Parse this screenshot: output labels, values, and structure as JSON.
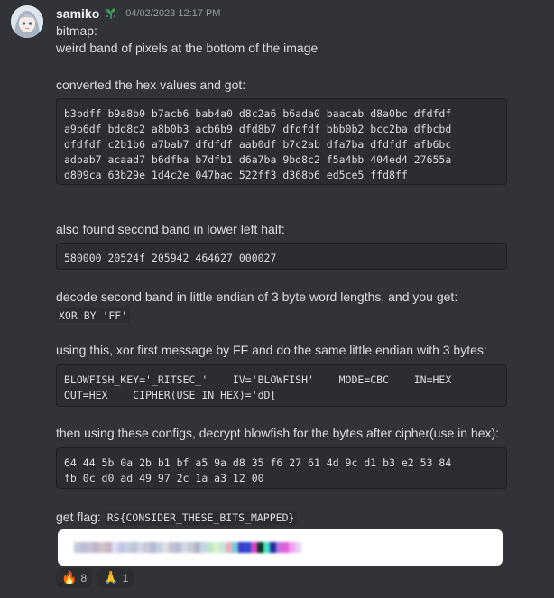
{
  "message": {
    "username": "samiko",
    "timestamp": "04/02/2023 12:17 PM",
    "lines": {
      "l1": "bitmap:",
      "l2": "weird band of pixels at the bottom of the image",
      "l3": "converted the hex values and got:",
      "l4": "also found second band in lower left half:",
      "l5": "decode second band in little endian of 3 byte word lengths, and you get:",
      "l6_code": "XOR BY 'FF'",
      "l7": "using this, xor first message by FF and do the same little endian with 3 bytes:",
      "l8": "then using these configs, decrypt blowfish for the bytes after cipher(use in hex):",
      "l9_prefix": "get flag:",
      "l9_code": "RS{CONSIDER_THESE_BITS_MAPPED}"
    },
    "code_blocks": {
      "hex1": "b3bdff b9a8b0 b7acb6 bab4a0 d8c2a6 b6ada0 baacab d8a0bc dfdfdf\na9b6df bdd8c2 a8b0b3 acb6b9 dfd8b7 dfdfdf bbb0b2 bcc2ba dfbcbd\ndfdfdf c2b1b6 a7bab7 dfdfdf aab0df b7c2ab dfa7ba dfdfdf afb6bc\nadbab7 acaad7 b6dfba b7dfb1 d6a7ba 9bd8c2 f5a4bb 404ed4 27655a\nd809ca 63b29e 1d4c2e 047bac 522ff3 d368b6 ed5ce5 ffd8ff",
      "hex2": "580000 20524f 205942 464627 000027",
      "config": "BLOWFISH_KEY='_RITSEC_'    IV='BLOWFISH'    MODE=CBC    IN=HEX\nOUT=HEX    CIPHER(USE IN HEX)='dD[",
      "cipher": "64 44 5b 0a 2b b1 bf a5 9a d8 35 f6 27 61 4d 9c d1 b3 e2 53 84\nfb 0c d0 ad 49 97 2c 1a a3 12 00"
    }
  },
  "reactions": [
    {
      "icon": "fire-icon",
      "emoji": "🔥",
      "count": "8"
    },
    {
      "icon": "pray-icon",
      "emoji": "🙏",
      "count": "1"
    }
  ],
  "pixel_strip_colors": [
    "#c6c9de",
    "#b8bdd8",
    "#c9c0d4",
    "#b8b8c8",
    "#d1c1cc",
    "#c9b5c5",
    "#dcdcf0",
    "#bfc6e6",
    "#c7d0de",
    "#b9c8d8",
    "#d5d5e6",
    "#c5cad8",
    "#b4b9d6",
    "#c6d0e0",
    "#dfdfdf",
    "#c5c0d9",
    "#b8bdd6",
    "#d0d6e4",
    "#c9c9d3",
    "#b0b4c6",
    "#c6d4e8",
    "#bde6c9",
    "#d9f0c8",
    "#c8e6d8",
    "#eab0c0",
    "#78c8d0",
    "#3a3ad0",
    "#2a4ad0",
    "#e040c8",
    "#103828",
    "#40e0c0",
    "#2030a0",
    "#c070e0",
    "#e060d8",
    "#f0a0f0",
    "#e8d0f8"
  ]
}
